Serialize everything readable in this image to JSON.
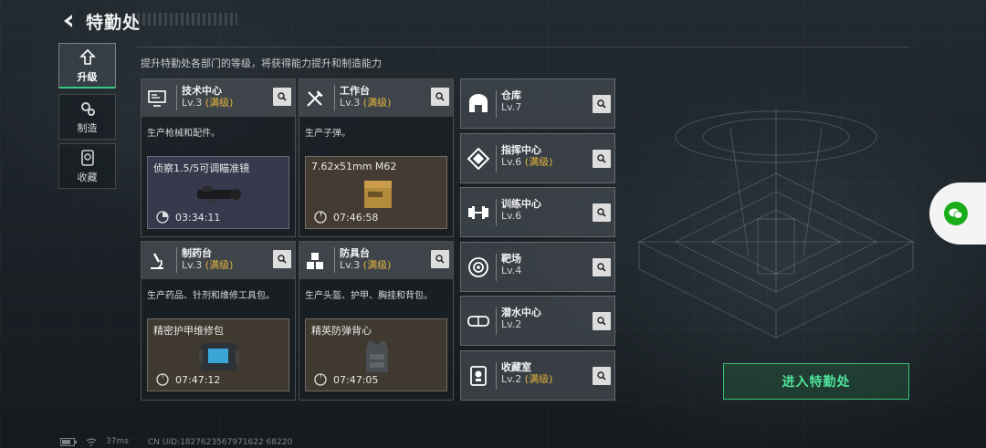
{
  "header": {
    "title": "特勤处"
  },
  "tabs": [
    {
      "label": "升级",
      "icon": "upgrade-icon",
      "active": true
    },
    {
      "label": "制造",
      "icon": "gears-icon",
      "active": false
    },
    {
      "label": "收藏",
      "icon": "collection-icon",
      "active": false
    }
  ],
  "subtitle": "提升特勤处各部门的等级，将获得能力提升和制造能力",
  "departments": [
    {
      "name": "技术中心",
      "level": "Lv.3",
      "maxed": "(满级)",
      "desc": "生产枪械和配件。",
      "item": "侦察1.5/5可调瞄准镜",
      "time": "03:34:11",
      "icon": "monitor-icon"
    },
    {
      "name": "工作台",
      "level": "Lv.3",
      "maxed": "(满级)",
      "desc": "生产子弹。",
      "item": "7.62x51mm M62",
      "time": "07:46:58",
      "icon": "tools-icon"
    },
    {
      "name": "制药台",
      "level": "Lv.3",
      "maxed": "(满级)",
      "desc": "生产药品、针剂和维修工具包。",
      "item": "精密护甲维修包",
      "time": "07:47:12",
      "icon": "microscope-icon"
    },
    {
      "name": "防具台",
      "level": "Lv.3",
      "maxed": "(满级)",
      "desc": "生产头盔、护甲、胸挂和背包。",
      "item": "精英防弹背心",
      "time": "07:47:05",
      "icon": "cubes-icon"
    }
  ],
  "mini": [
    {
      "name": "仓库",
      "level": "Lv.7",
      "maxed": "",
      "icon": "warehouse-icon"
    },
    {
      "name": "指挥中心",
      "level": "Lv.6",
      "maxed": "(满级)",
      "icon": "command-icon"
    },
    {
      "name": "训练中心",
      "level": "Lv.6",
      "maxed": "",
      "icon": "dumbbell-icon"
    },
    {
      "name": "靶场",
      "level": "Lv.4",
      "maxed": "",
      "icon": "target-icon"
    },
    {
      "name": "潜水中心",
      "level": "Lv.2",
      "maxed": "",
      "icon": "goggles-icon"
    },
    {
      "name": "收藏室",
      "level": "Lv.2",
      "maxed": "(满级)",
      "icon": "trophy-icon"
    }
  ],
  "enter_button": "进入特勤处",
  "status": {
    "ping": "37ms",
    "uid": "CN UID:1827623567971622 68220"
  },
  "colors": {
    "accent": "#39c77b",
    "maxed": "#e2b33c"
  }
}
